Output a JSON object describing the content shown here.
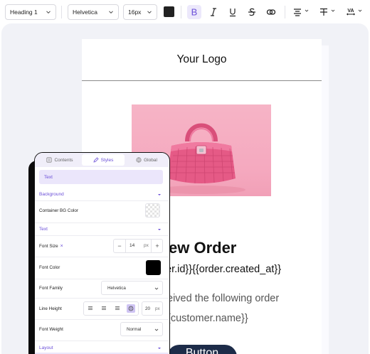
{
  "toolbar": {
    "block_type": "Heading 1",
    "font_family": "Helvetica",
    "font_size": "16px",
    "text_color": "#222222",
    "bold_active": true,
    "icons": [
      "bold-icon",
      "italic-icon",
      "underline-icon",
      "strikethrough-icon",
      "link-icon",
      "align-center-icon",
      "text-style-icon",
      "letter-spacing-icon"
    ]
  },
  "email": {
    "logo_text": "Your Logo",
    "heading": "ew Order",
    "ids_line": "er.id}}{{order.created_at}}",
    "received_line": "eived the following order",
    "customer_line": "{customer.name}}",
    "button_label": "Button",
    "button_color": "#1d2c49",
    "accent_pink": "#f5a9bf"
  },
  "panel": {
    "tabs": [
      {
        "label": "Contents",
        "icon": "contents-icon"
      },
      {
        "label": "Styles",
        "icon": "styles-icon",
        "active": true
      },
      {
        "label": "Global",
        "icon": "global-icon"
      }
    ],
    "selected_element": "Text",
    "background_section": "Background",
    "container_bg_label": "Container BG Color",
    "text_section": "Text",
    "font_size_label": "Font Size",
    "font_size_reset": "×",
    "font_size_minus": "−",
    "font_size_value": "14",
    "font_size_unit": "px",
    "font_size_plus": "+",
    "font_color_label": "Font Color",
    "font_color": "#000000",
    "font_family_label": "Font Family",
    "font_family_value": "Helvetica",
    "line_height_label": "Line Height",
    "line_height_value": "20",
    "line_height_unit": "px",
    "font_weight_label": "Font Weight",
    "font_weight_value": "Normal",
    "layout_section": "Layout",
    "accent": "#6b4fd8"
  }
}
